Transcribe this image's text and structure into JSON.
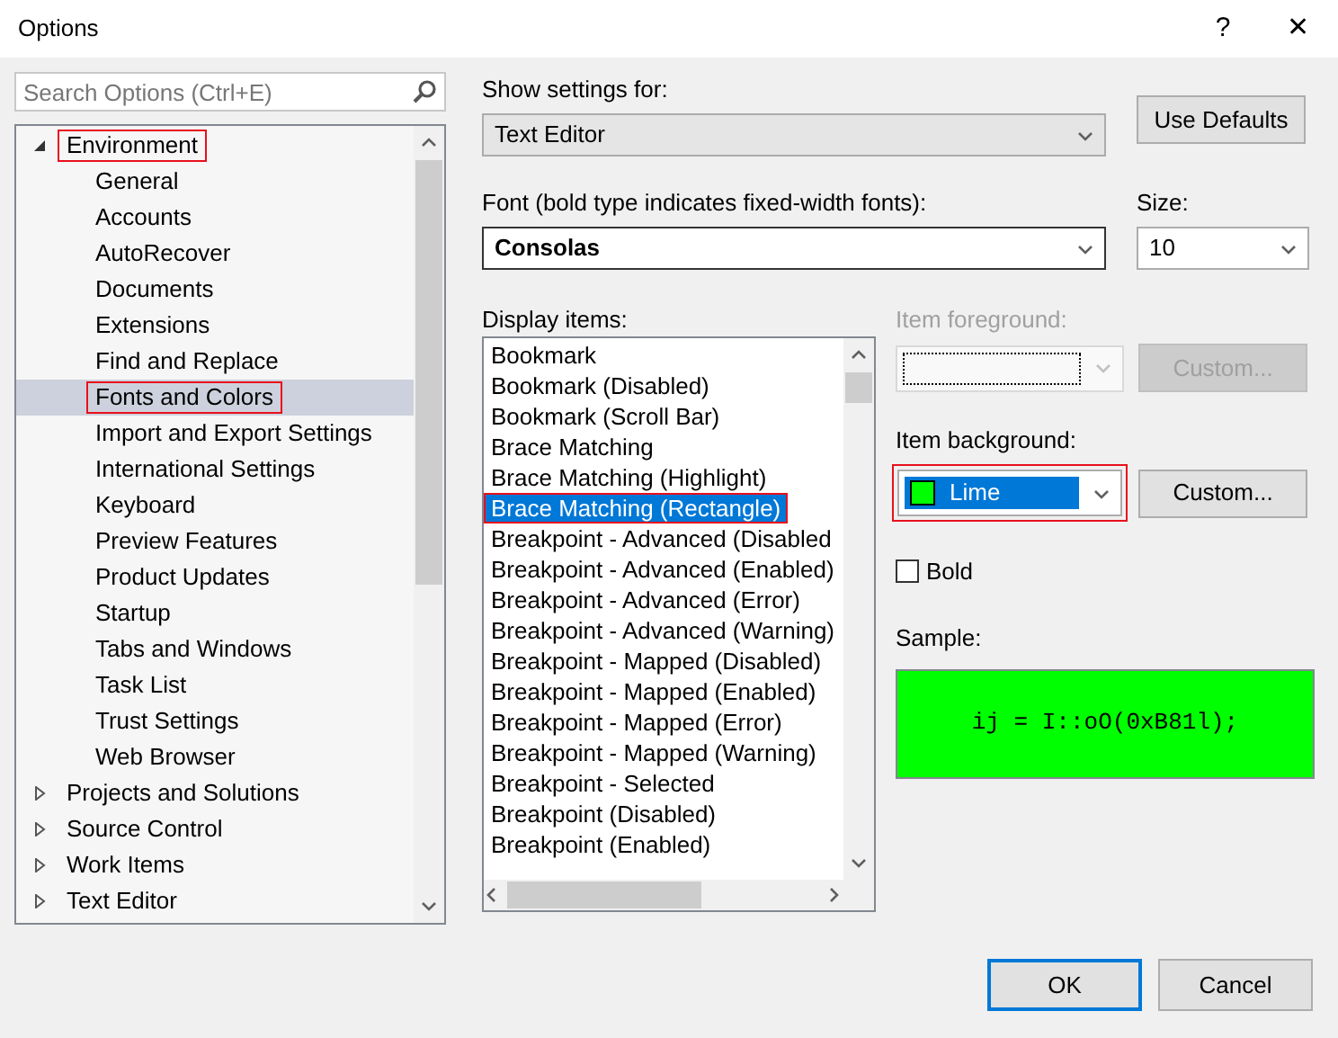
{
  "window": {
    "title": "Options",
    "title_buttons": [
      "?",
      "✕"
    ]
  },
  "search": {
    "placeholder": "Search Options (Ctrl+E)"
  },
  "tree": [
    {
      "label": "Environment",
      "expanded": true,
      "selected": false,
      "highlighted": true,
      "children": [
        {
          "label": "General",
          "selected": false,
          "highlighted": false
        },
        {
          "label": "Accounts",
          "selected": false,
          "highlighted": false
        },
        {
          "label": "AutoRecover",
          "selected": false,
          "highlighted": false
        },
        {
          "label": "Documents",
          "selected": false,
          "highlighted": false
        },
        {
          "label": "Extensions",
          "selected": false,
          "highlighted": false
        },
        {
          "label": "Find and Replace",
          "selected": false,
          "highlighted": false
        },
        {
          "label": "Fonts and Colors",
          "selected": true,
          "highlighted": true
        },
        {
          "label": "Import and Export Settings",
          "selected": false,
          "highlighted": false
        },
        {
          "label": "International Settings",
          "selected": false,
          "highlighted": false
        },
        {
          "label": "Keyboard",
          "selected": false,
          "highlighted": false
        },
        {
          "label": "Preview Features",
          "selected": false,
          "highlighted": false
        },
        {
          "label": "Product Updates",
          "selected": false,
          "highlighted": false
        },
        {
          "label": "Startup",
          "selected": false,
          "highlighted": false
        },
        {
          "label": "Tabs and Windows",
          "selected": false,
          "highlighted": false
        },
        {
          "label": "Task List",
          "selected": false,
          "highlighted": false
        },
        {
          "label": "Trust Settings",
          "selected": false,
          "highlighted": false
        },
        {
          "label": "Web Browser",
          "selected": false,
          "highlighted": false
        }
      ]
    },
    {
      "label": "Projects and Solutions",
      "expanded": false,
      "selected": false,
      "highlighted": false
    },
    {
      "label": "Source Control",
      "expanded": false,
      "selected": false,
      "highlighted": false
    },
    {
      "label": "Work Items",
      "expanded": false,
      "selected": false,
      "highlighted": false
    },
    {
      "label": "Text Editor",
      "expanded": false,
      "selected": false,
      "highlighted": false
    }
  ],
  "show_settings": {
    "label": "Show settings for:",
    "value": "Text Editor",
    "button": "Use Defaults"
  },
  "font": {
    "label": "Font (bold type indicates fixed-width fonts):",
    "value": "Consolas"
  },
  "size": {
    "label": "Size:",
    "value": "10"
  },
  "display_items": {
    "label": "Display items:",
    "items": [
      {
        "label": "Bookmark",
        "selected": false,
        "highlighted": false
      },
      {
        "label": "Bookmark (Disabled)",
        "selected": false,
        "highlighted": false
      },
      {
        "label": "Bookmark (Scroll Bar)",
        "selected": false,
        "highlighted": false
      },
      {
        "label": "Brace Matching",
        "selected": false,
        "highlighted": false
      },
      {
        "label": "Brace Matching (Highlight)",
        "selected": false,
        "highlighted": false
      },
      {
        "label": "Brace Matching (Rectangle)",
        "selected": true,
        "highlighted": true
      },
      {
        "label": "Breakpoint - Advanced (Disabled",
        "selected": false,
        "highlighted": false
      },
      {
        "label": "Breakpoint - Advanced (Enabled)",
        "selected": false,
        "highlighted": false
      },
      {
        "label": "Breakpoint - Advanced (Error)",
        "selected": false,
        "highlighted": false
      },
      {
        "label": "Breakpoint - Advanced (Warning)",
        "selected": false,
        "highlighted": false
      },
      {
        "label": "Breakpoint - Mapped (Disabled)",
        "selected": false,
        "highlighted": false
      },
      {
        "label": "Breakpoint - Mapped (Enabled)",
        "selected": false,
        "highlighted": false
      },
      {
        "label": "Breakpoint - Mapped (Error)",
        "selected": false,
        "highlighted": false
      },
      {
        "label": "Breakpoint - Mapped (Warning)",
        "selected": false,
        "highlighted": false
      },
      {
        "label": "Breakpoint - Selected",
        "selected": false,
        "highlighted": false
      },
      {
        "label": "Breakpoint (Disabled)",
        "selected": false,
        "highlighted": false
      },
      {
        "label": "Breakpoint (Enabled)",
        "selected": false,
        "highlighted": false
      }
    ]
  },
  "item_foreground": {
    "label": "Item foreground:",
    "disabled": true,
    "button": "Custom..."
  },
  "item_background": {
    "label": "Item background:",
    "value": "Lime",
    "color": "#00ff00",
    "disabled": false,
    "highlighted": true,
    "button": "Custom..."
  },
  "bold": {
    "label": "Bold",
    "checked": false
  },
  "sample": {
    "label": "Sample:",
    "text": "ij = I::oO(0xB81l);",
    "color": "#00ff00"
  },
  "buttons": [
    {
      "label": "OK",
      "default": true
    },
    {
      "label": "Cancel",
      "default": false
    }
  ]
}
